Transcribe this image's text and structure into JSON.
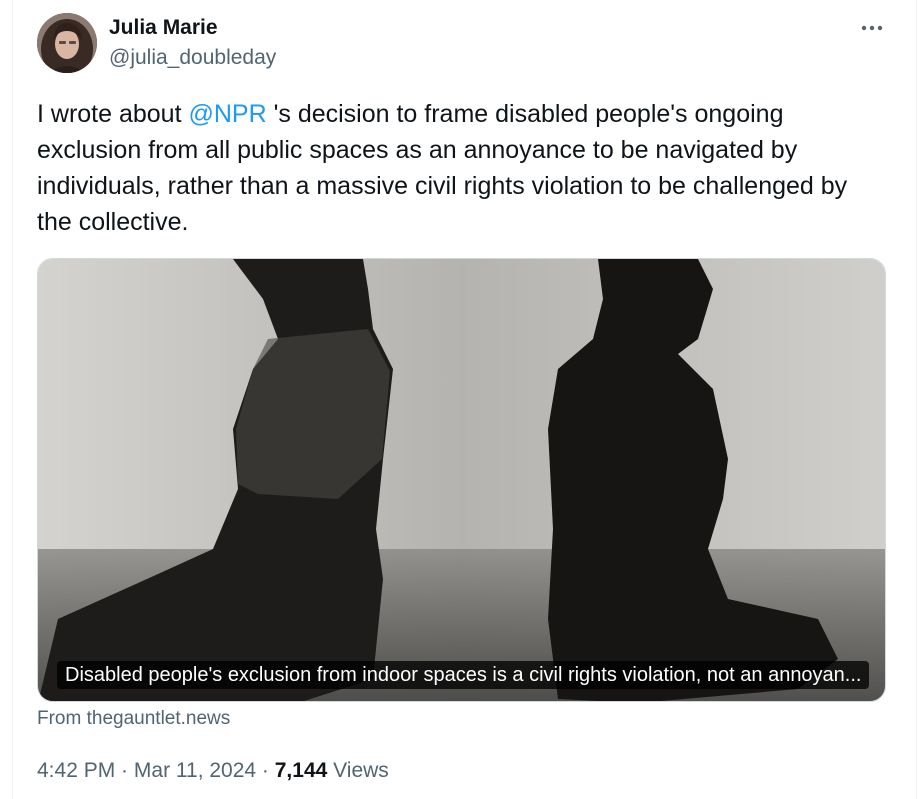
{
  "author": {
    "name": "Julia Marie",
    "handle": "@julia_doubleday"
  },
  "tweet": {
    "text_before": "I wrote about ",
    "mention": "@NPR",
    "text_after": " 's decision to frame disabled people's ongoing exclusion from all public spaces as an annoyance to be navigated by individuals, rather than a massive civil rights violation to be challenged by the collective."
  },
  "card": {
    "caption": "Disabled people's exclusion from indoor spaces is a civil rights violation, not an annoyan...",
    "source": "From thegauntlet.news"
  },
  "meta": {
    "time": "4:42 PM",
    "sep1": " · ",
    "date": "Mar 11, 2024",
    "sep2": " · ",
    "views_count": "7,144",
    "views_label": " Views"
  },
  "icons": {
    "more": "more-horizontal-icon"
  },
  "colors": {
    "link": "#1d9bf0",
    "secondary_text": "#536471",
    "primary_text": "#0f1419"
  }
}
